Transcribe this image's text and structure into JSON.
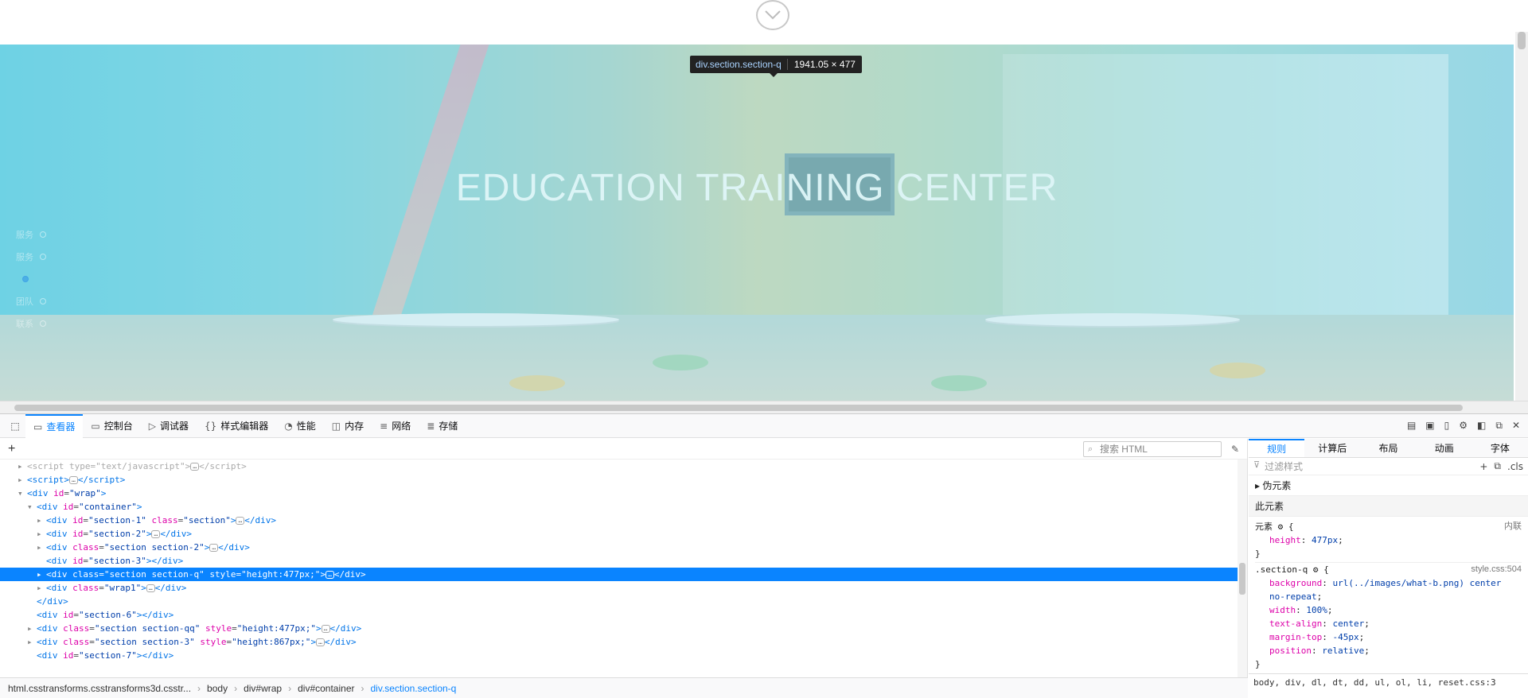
{
  "page": {
    "hero_title": "EDUCATION TRAINING CENTER",
    "side_nav": [
      "服务",
      "服务",
      "",
      "团队",
      "联系"
    ],
    "scroll_down_icon": "chevron-down-icon"
  },
  "tooltip": {
    "tag": "div.section.section-q",
    "size": "1941.05 × 477"
  },
  "devtools": {
    "tabs": [
      {
        "label": "查看器",
        "icon": "inspector-icon"
      },
      {
        "label": "控制台",
        "icon": "console-icon"
      },
      {
        "label": "调试器",
        "icon": "debugger-icon"
      },
      {
        "label": "样式编辑器",
        "icon": "style-editor-icon"
      },
      {
        "label": "性能",
        "icon": "performance-icon"
      },
      {
        "label": "内存",
        "icon": "memory-icon"
      },
      {
        "label": "网络",
        "icon": "network-icon"
      },
      {
        "label": "存储",
        "icon": "storage-icon"
      }
    ],
    "search_placeholder": "搜索 HTML",
    "breadcrumb": [
      "html.csstransforms.csstransforms3d.csstr...",
      "body",
      "div#wrap",
      "div#container",
      "div.section.section-q"
    ],
    "rules_tabs": [
      "规则",
      "计算后",
      "布局",
      "动画",
      "字体"
    ],
    "filter_placeholder": "过滤样式",
    "filter_cls": ".cls",
    "pseudo_label": "伪元素",
    "this_element_label": "此元素",
    "element_label": "元素",
    "inline_label": "内联",
    "inline_prop": {
      "name": "height",
      "value": "477px"
    },
    "rule_selector": ".section-q",
    "rule_source": "style.css:504",
    "rule_props": [
      {
        "name": "background",
        "value": "url(../images/what-b.png) center no-repeat"
      },
      {
        "name": "width",
        "value": "100%"
      },
      {
        "name": "text-align",
        "value": "center"
      },
      {
        "name": "margin-top",
        "value": "-45px"
      },
      {
        "name": "position",
        "value": "relative"
      }
    ],
    "rules_bottom": "body, div, dl, dt, dd, ul, ol, li, reset.css:3"
  }
}
